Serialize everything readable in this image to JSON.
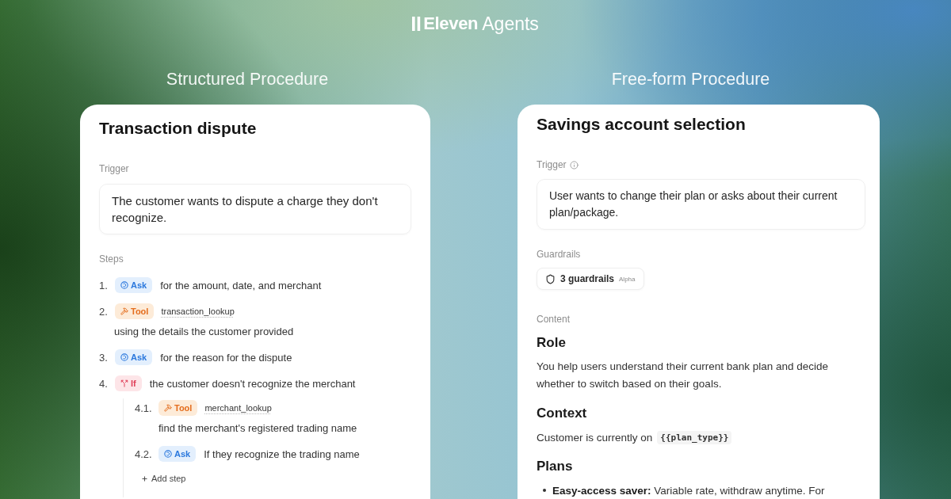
{
  "brand": {
    "name": "Eleven",
    "product": "Agents"
  },
  "panels": [
    {
      "kind": "structured",
      "heading": "Structured Procedure",
      "title": "Transaction dispute",
      "trigger": {
        "label": "Trigger",
        "value": "The customer wants to dispute a charge they don't recognize."
      },
      "steps": {
        "label": "Steps",
        "items": [
          {
            "number": "1.",
            "action": {
              "kind": "ask",
              "label": "Ask"
            },
            "text": "for the amount, date, and merchant"
          },
          {
            "number": "2.",
            "action": {
              "kind": "tool",
              "label": "Tool"
            },
            "tool_name": "transaction_lookup",
            "text": "using the details the customer provided"
          },
          {
            "number": "3.",
            "action": {
              "kind": "ask",
              "label": "Ask"
            },
            "text": "for the reason for the dispute"
          },
          {
            "number": "4.",
            "action": {
              "kind": "if",
              "label": "If"
            },
            "text": "the customer doesn't recognize the merchant",
            "children": [
              {
                "number": "4.1.",
                "action": {
                  "kind": "tool",
                  "label": "Tool"
                },
                "tool_name": "merchant_lookup",
                "text": "find the merchant's registered trading name"
              },
              {
                "number": "4.2.",
                "action": {
                  "kind": "ask",
                  "label": "Ask"
                },
                "text": "If they recognize the trading name"
              }
            ],
            "add_step": "Add step"
          }
        ]
      }
    },
    {
      "kind": "freeform",
      "heading": "Free-form Procedure",
      "title": "Savings account selection",
      "trigger": {
        "label": "Trigger",
        "value": "User wants to change their plan or asks about their current plan/package."
      },
      "guardrails": {
        "label": "Guardrails",
        "count_text": "3 guardrails",
        "tag": "Alpha"
      },
      "content": {
        "label": "Content",
        "blocks": [
          {
            "kind": "heading",
            "text": "Role"
          },
          {
            "kind": "paragraph",
            "text": "You help users understand their current bank plan and decide whether to switch based on their goals."
          },
          {
            "kind": "heading",
            "text": "Context"
          },
          {
            "kind": "variable_line",
            "text": "Customer is currently on",
            "variable": "{{plan_type}}"
          },
          {
            "kind": "heading",
            "text": "Plans"
          },
          {
            "kind": "bullet",
            "text": "**Easy-access saver:** Variable rate, withdraw anytime. For"
          }
        ]
      }
    }
  ]
}
